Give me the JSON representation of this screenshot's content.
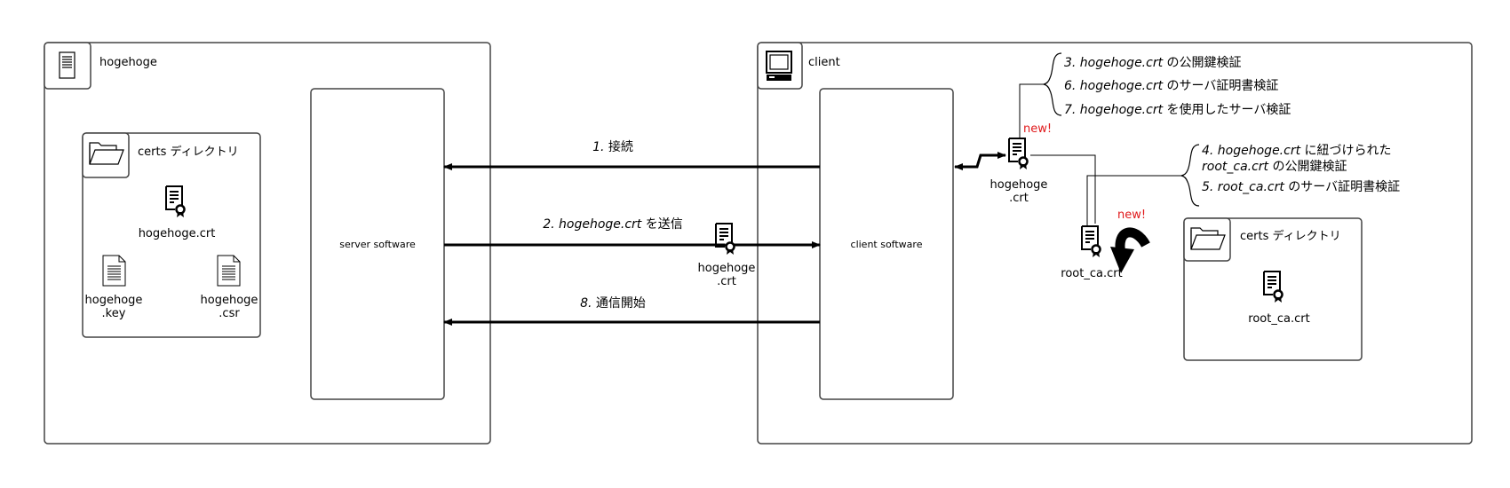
{
  "server": {
    "title": "hogehoge",
    "software_label": "server software",
    "certs_dir": {
      "label": "certs ディレクトリ",
      "cert_file": "hogehoge.crt",
      "key_file_line1": "hogehoge",
      "key_file_line2": ".key",
      "csr_file_line1": "hogehoge",
      "csr_file_line2": ".csr"
    }
  },
  "client": {
    "title": "client",
    "software_label": "client software",
    "received_cert_line1": "hogehoge",
    "received_cert_line2": ".crt",
    "root_cert": "root_ca.crt",
    "new_badge_1": "new!",
    "new_badge_2": "new!",
    "certs_dir": {
      "label": "certs ディレクトリ",
      "cert_file": "root_ca.crt"
    }
  },
  "messages": {
    "connect": {
      "num": "1.",
      "text": " 接続"
    },
    "send_cert": {
      "num": "2.",
      "file": " hogehoge.crt",
      "text": " を送信"
    },
    "start": {
      "num": "8.",
      "text": " 通信開始"
    }
  },
  "transit_cert": {
    "line1": "hogehoge",
    "line2": ".crt"
  },
  "steps_hogehoge": [
    {
      "num": "3.",
      "file": " hogehoge.crt",
      "text": " の公開鍵検証"
    },
    {
      "num": "6.",
      "file": " hogehoge.crt",
      "text": " のサーバ証明書検証"
    },
    {
      "num": "7.",
      "file": " hogehoge.crt",
      "text": " を使用したサーバ検証"
    }
  ],
  "steps_root": {
    "step4_num": "4.",
    "step4_file": " hogehoge.crt",
    "step4_text": " に紐づけられた",
    "step4_file2": "root_ca.crt",
    "step4_text2": " の公開鍵検証",
    "step5_num": "5.",
    "step5_file": " root_ca.crt",
    "step5_text": " のサーバ証明書検証"
  },
  "icons": [
    "server-icon",
    "monitor-icon",
    "folder-icon",
    "certificate-icon",
    "document-icon",
    "curved-arrow-icon"
  ]
}
